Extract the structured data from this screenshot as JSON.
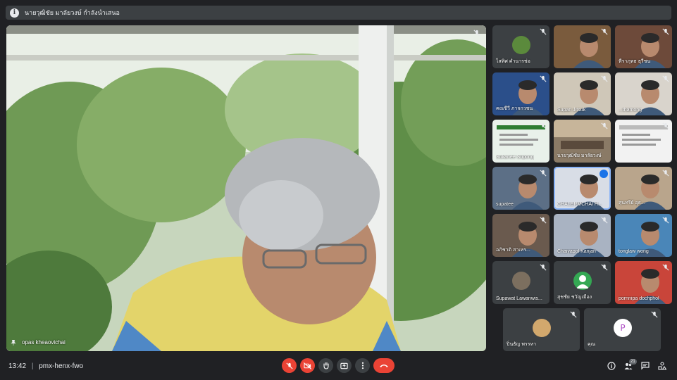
{
  "banner": {
    "text": "นายวุฒิชัย มาลัยวงษ์ กำลังนำเสนอ"
  },
  "main_video": {
    "participant_name": "opas kheaovichai"
  },
  "tiles": [
    {
      "label": "ไสทิศ คำนารช่อ"
    },
    {
      "label": ""
    },
    {
      "label": "ทีราภุทธ ธุรีชน"
    },
    {
      "label": "คณชีวี ภาจกวชน"
    },
    {
      "label": "Supan Jitsuk"
    },
    {
      "label": "...thamong"
    },
    {
      "label": "Sukanee Sripong"
    },
    {
      "label": "นายวุฒิชัย มาลัยวงษ์"
    },
    {
      "label": ""
    },
    {
      "label": "supatee"
    },
    {
      "label": "CHALERMCHAI H..."
    },
    {
      "label": "สุนทรีย์ อุธ..."
    },
    {
      "label": "อภิชาติ สาเหร..."
    },
    {
      "label": "Chaiyapol Kanjan"
    },
    {
      "label": "tonglaw wong"
    },
    {
      "label": "Supawat Lawanwis..."
    },
    {
      "label": "สุชชัย ชวัญเมือง"
    },
    {
      "label": "pornnipa dochphol"
    },
    {
      "label": "ปิ่นธัญ พรรหา"
    },
    {
      "label": "คุณ"
    }
  ],
  "bottom_bar": {
    "time": "13:42",
    "separator": "|",
    "meeting_code": "pmx-henx-fwo",
    "participants_count": "21"
  },
  "colors": {
    "background": "#202124",
    "tile": "#3c4043",
    "danger": "#ea4335",
    "speaking": "#8ab4f8"
  }
}
